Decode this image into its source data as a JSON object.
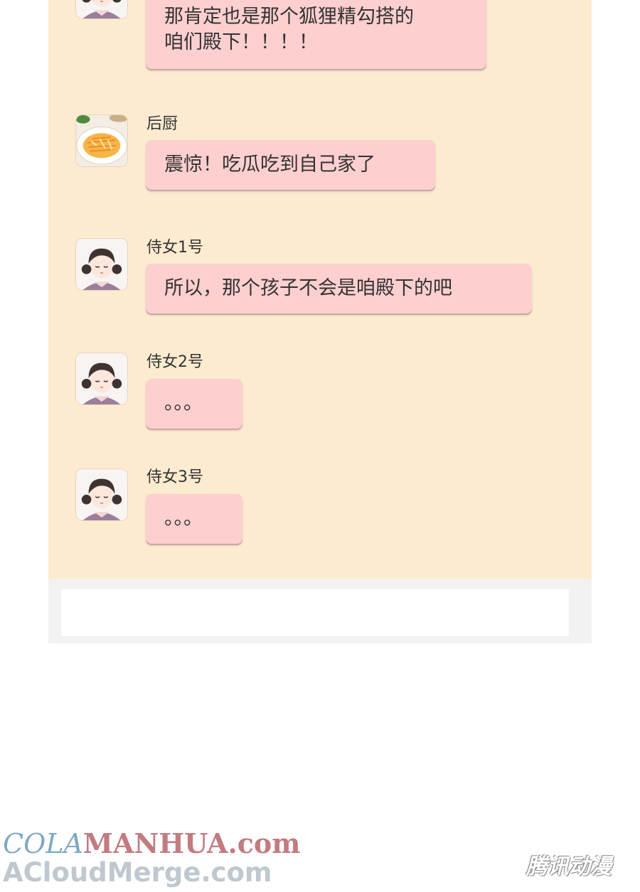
{
  "messages": [
    {
      "sender": "",
      "avatar": "maid-avatar-icon",
      "text_lines": [
        "那肯定也是那个狐狸精勾搭的",
        "咱们殿下！！！！"
      ]
    },
    {
      "sender": "后厨",
      "avatar": "food-plate-avatar-icon",
      "text_lines": [
        "震惊！吃瓜吃到自己家了"
      ]
    },
    {
      "sender": "侍女1号",
      "avatar": "maid-avatar-icon",
      "text_lines": [
        "所以，那个孩子不会是咱殿下的吧"
      ]
    },
    {
      "sender": "侍女2号",
      "avatar": "maid-avatar-icon",
      "text_lines": [
        "。。。"
      ]
    },
    {
      "sender": "侍女3号",
      "avatar": "maid-avatar-icon",
      "text_lines": [
        "。。。"
      ]
    }
  ],
  "input": {
    "value": ""
  },
  "watermarks": {
    "line1_part1": "COLA",
    "line1_part2": "MANHUA.com",
    "line2": "ACloudMerge.com",
    "corner": "腾讯动漫"
  },
  "colors": {
    "chat_background": "#fdebd0",
    "bubble": "#fdcfcf",
    "input_bar": "#f2f2f2"
  }
}
